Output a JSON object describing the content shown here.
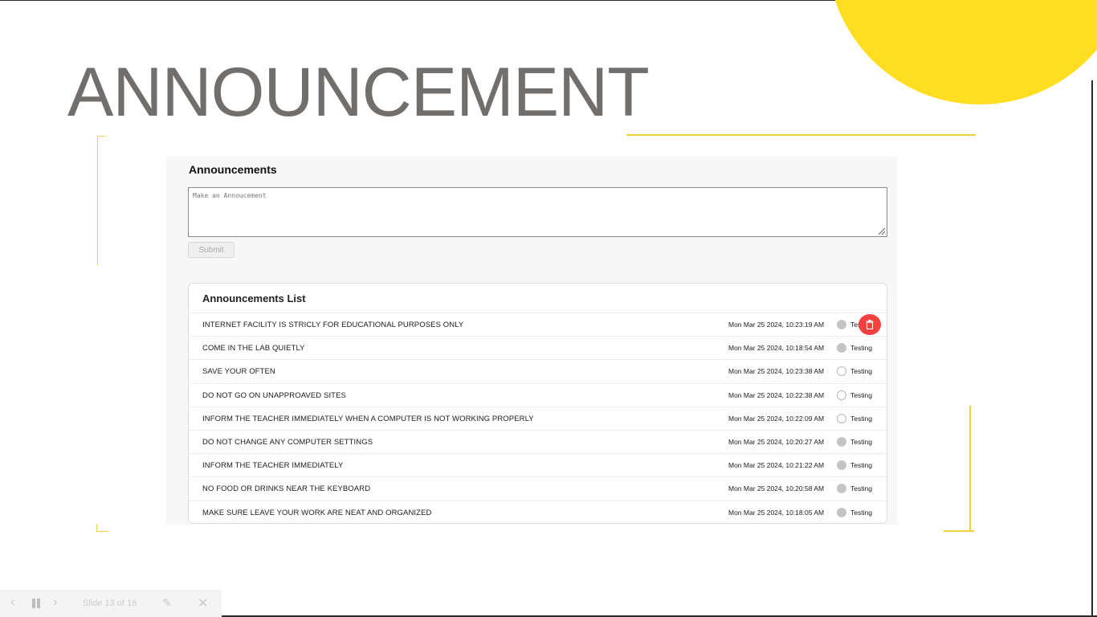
{
  "slide": {
    "title": "ANNOUNCEMENT",
    "accent_color": "#ffde21"
  },
  "panel": {
    "heading": "Announcements",
    "compose_placeholder": "Make an Annoucement",
    "submit_label": "Submit"
  },
  "list": {
    "title": "Announcements List",
    "items": [
      {
        "text": "INTERNET FACILITY IS STRICLY FOR EDUCATIONAL PURPOSES ONLY",
        "date": "Mon Mar 25 2024, 10:23:19 AM",
        "author": "Testing",
        "dot": "filled"
      },
      {
        "text": "COME IN THE LAB QUIETLY",
        "date": "Mon Mar 25 2024, 10:18:54 AM",
        "author": "Testing",
        "dot": "filled"
      },
      {
        "text": "SAVE YOUR OFTEN",
        "date": "Mon Mar 25 2024, 10:23:38 AM",
        "author": "Testing",
        "dot": "empty"
      },
      {
        "text": "DO NOT GO ON UNAPPROAVED SITES",
        "date": "Mon Mar 25 2024, 10:22:38 AM",
        "author": "Testing",
        "dot": "empty"
      },
      {
        "text": "INFORM THE TEACHER IMMEDIATELY WHEN A COMPUTER IS NOT WORKING PROPERLY",
        "date": "Mon Mar 25 2024, 10:22:09 AM",
        "author": "Testing",
        "dot": "empty"
      },
      {
        "text": "DO NOT CHANGE ANY COMPUTER SETTINGS",
        "date": "Mon Mar 25 2024, 10:20:27 AM",
        "author": "Testing",
        "dot": "filled"
      },
      {
        "text": "INFORM THE TEACHER IMMEDIATELY",
        "date": "Mon Mar 25 2024, 10:21:22 AM",
        "author": "Testing",
        "dot": "filled"
      },
      {
        "text": "NO FOOD OR DRINKS NEAR THE KEYBOARD",
        "date": "Mon Mar 25 2024, 10:20:58 AM",
        "author": "Testing",
        "dot": "filled"
      },
      {
        "text": "MAKE SURE LEAVE YOUR WORK ARE NEAT AND ORGANIZED",
        "date": "Mon Mar 25 2024, 10:18:05 AM",
        "author": "Testing",
        "dot": "filled"
      }
    ],
    "delete_color": "#f2413f"
  },
  "presenter": {
    "prev_icon": "chevron-left-icon",
    "pause_icon": "pause-icon",
    "next_icon": "chevron-right-icon",
    "counter": "Slide 13 of 16",
    "pen_icon": "pen-icon",
    "close_icon": "close-icon"
  }
}
